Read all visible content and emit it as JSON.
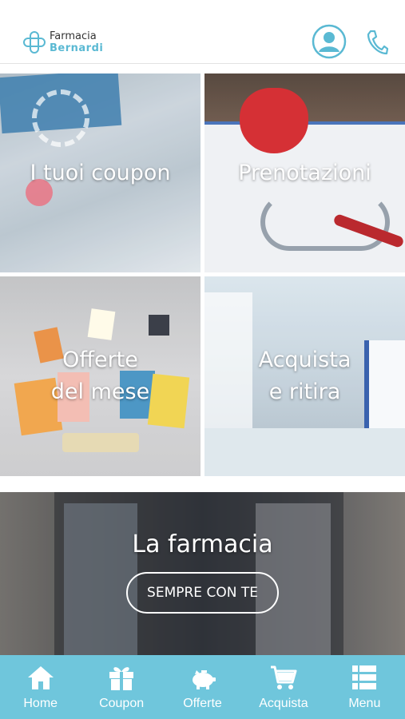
{
  "header": {
    "logo": {
      "line1": "Farmacia",
      "line2": "Bernardi"
    },
    "icons": {
      "user": "user-icon",
      "phone": "phone-icon"
    },
    "accent": "#5ab9d3"
  },
  "tiles": [
    {
      "label": "I tuoi coupon"
    },
    {
      "label": "Prenotazioni"
    },
    {
      "label": "Offerte\ndel mese"
    },
    {
      "label": "Acquista\ne ritira"
    }
  ],
  "banner": {
    "title": "La farmacia",
    "button": "SEMPRE CON TE"
  },
  "nav": {
    "background": "#6fc6dc",
    "items": [
      {
        "label": "Home",
        "icon": "home-icon"
      },
      {
        "label": "Coupon",
        "icon": "gift-icon"
      },
      {
        "label": "Offerte",
        "icon": "piggy-bank-icon"
      },
      {
        "label": "Acquista",
        "icon": "cart-icon"
      },
      {
        "label": "Menu",
        "icon": "menu-list-icon"
      }
    ]
  }
}
